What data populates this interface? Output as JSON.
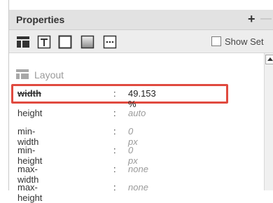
{
  "panel": {
    "title": "Properties",
    "add_symbol": "+",
    "remove_symbol": "—"
  },
  "toolbar": {
    "icons": [
      "layout-icon",
      "text-icon",
      "border-icon",
      "background-icon",
      "more-icon"
    ],
    "show_set_label": "Show Set",
    "show_set_checked": false
  },
  "section": {
    "label": "Layout"
  },
  "properties": [
    {
      "name": "width",
      "value": "49.153 %",
      "set": true
    },
    {
      "name": "height",
      "value": "auto",
      "set": false
    },
    {
      "name": "min-width",
      "value": "0 px",
      "set": false
    },
    {
      "name": "min-height",
      "value": "0 px",
      "set": false
    },
    {
      "name": "max-width",
      "value": "none",
      "set": false
    },
    {
      "name": "max-height",
      "value": "none",
      "set": false
    }
  ],
  "colors": {
    "highlight": "#e04a3f",
    "titlebar": "#e2e2e2",
    "toolbar": "#ededed"
  }
}
